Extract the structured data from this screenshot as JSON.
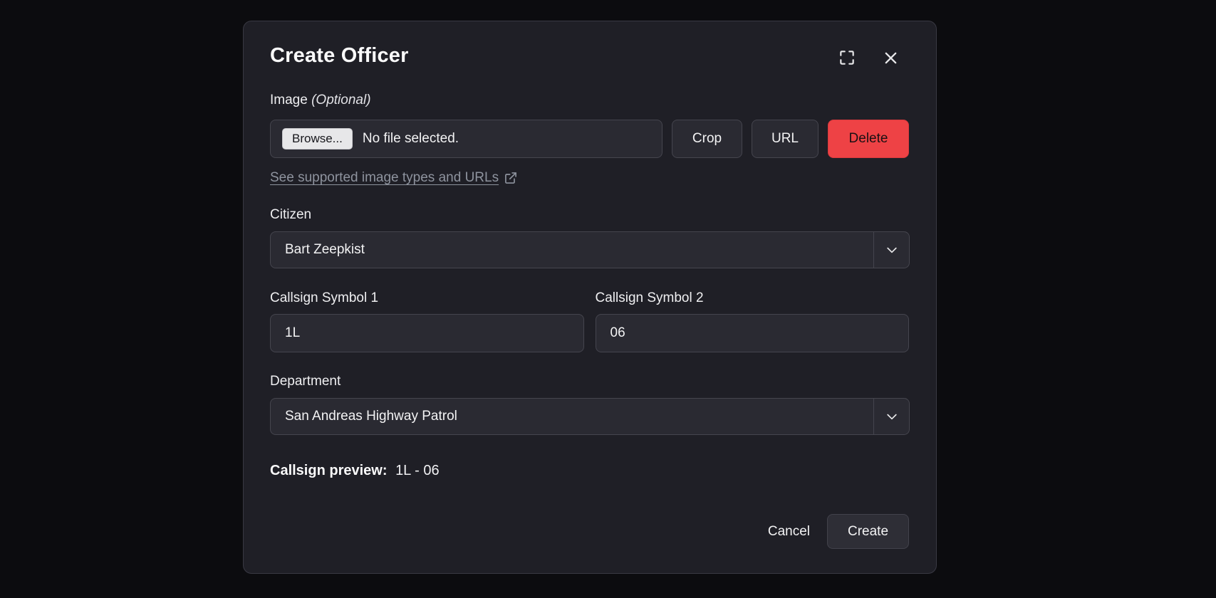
{
  "modal": {
    "title": "Create Officer",
    "image_section": {
      "label": "Image",
      "optional": "(Optional)",
      "browse_label": "Browse...",
      "no_file_text": "No file selected.",
      "crop_label": "Crop",
      "url_label": "URL",
      "delete_label": "Delete",
      "link_text": "See supported image types and URLs"
    },
    "citizen": {
      "label": "Citizen",
      "value": "Bart Zeepkist"
    },
    "callsign1": {
      "label": "Callsign Symbol 1",
      "value": "1L"
    },
    "callsign2": {
      "label": "Callsign Symbol 2",
      "value": "06"
    },
    "department": {
      "label": "Department",
      "value": "San Andreas Highway Patrol"
    },
    "preview": {
      "label": "Callsign preview:",
      "value": "1L - 06"
    },
    "footer": {
      "cancel_label": "Cancel",
      "create_label": "Create"
    }
  },
  "colors": {
    "page_background": "#0c0c0f",
    "modal_background": "#1f1f26",
    "input_background": "#2a2a32",
    "input_border": "#45454e",
    "danger": "#ee4245",
    "browse_button": "#e7e7e9",
    "link_muted": "#8e939e",
    "text": "#f1f1f3"
  }
}
